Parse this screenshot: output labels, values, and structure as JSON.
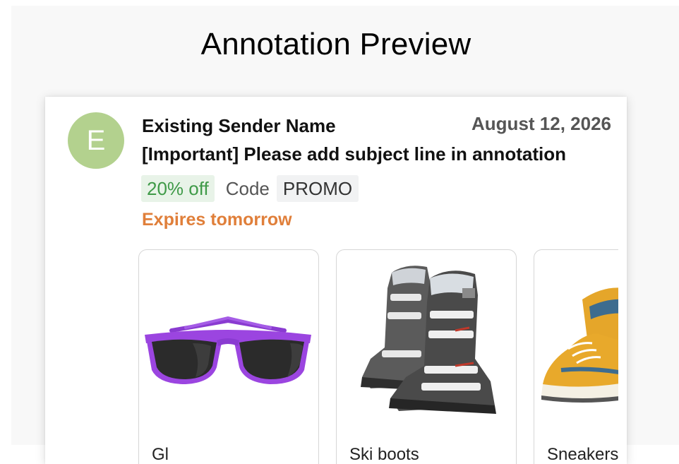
{
  "page": {
    "title": "Annotation Preview"
  },
  "email": {
    "avatar_letter": "E",
    "sender_name": "Existing Sender Name",
    "date": "August 12, 2026",
    "subject": "[Important] Please add subject line in annotation",
    "promo": {
      "discount": "20% off",
      "code_label": "Code",
      "code_value": "PROMO"
    },
    "expires": "Expires tomorrow"
  },
  "products": [
    {
      "label": "Gl",
      "image": "sunglasses-image"
    },
    {
      "label": "Ski boots",
      "image": "ski-boots-image"
    },
    {
      "label": "Sneakers",
      "image": "sneakers-image"
    }
  ],
  "colors": {
    "avatar": "#b3d18e",
    "discount_text": "#3f9a48",
    "expires_text": "#e07f3a"
  }
}
